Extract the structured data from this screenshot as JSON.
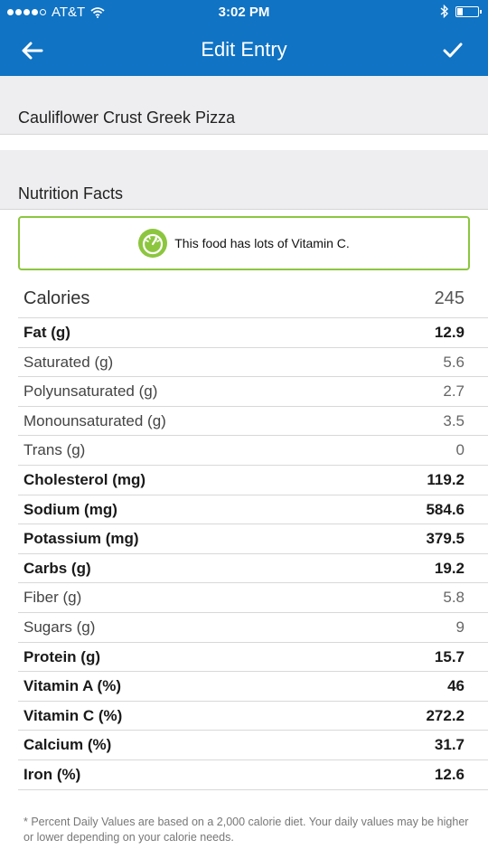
{
  "status_bar": {
    "carrier": "AT&T",
    "time": "3:02 PM",
    "signal_bars_filled": 4,
    "signal_bars_total": 5
  },
  "header": {
    "title": "Edit Entry",
    "back_icon": "arrow-left-icon",
    "confirm_icon": "checkmark-icon"
  },
  "food": {
    "name": "Cauliflower Crust Greek Pizza"
  },
  "nutrition": {
    "section_title": "Nutrition Facts",
    "highlight_text": "This food has lots of Vitamin C.",
    "calories_label": "Calories",
    "calories_value": "245",
    "rows": [
      {
        "label": "Fat (g)",
        "value": "12.9",
        "bold": true
      },
      {
        "label": "Saturated (g)",
        "value": "5.6",
        "bold": false
      },
      {
        "label": "Polyunsaturated (g)",
        "value": "2.7",
        "bold": false
      },
      {
        "label": "Monounsaturated (g)",
        "value": "3.5",
        "bold": false
      },
      {
        "label": "Trans (g)",
        "value": "0",
        "bold": false
      },
      {
        "label": "Cholesterol (mg)",
        "value": "119.2",
        "bold": true
      },
      {
        "label": "Sodium (mg)",
        "value": "584.6",
        "bold": true
      },
      {
        "label": "Potassium (mg)",
        "value": "379.5",
        "bold": true
      },
      {
        "label": "Carbs (g)",
        "value": "19.2",
        "bold": true
      },
      {
        "label": "Fiber (g)",
        "value": "5.8",
        "bold": false
      },
      {
        "label": "Sugars (g)",
        "value": "9",
        "bold": false
      },
      {
        "label": "Protein (g)",
        "value": "15.7",
        "bold": true
      },
      {
        "label": "Vitamin A (%)",
        "value": "46",
        "bold": true
      },
      {
        "label": "Vitamin C (%)",
        "value": "272.2",
        "bold": true
      },
      {
        "label": "Calcium (%)",
        "value": "31.7",
        "bold": true
      },
      {
        "label": "Iron (%)",
        "value": "12.6",
        "bold": true
      }
    ],
    "footnote": "* Percent Daily Values are based on a 2,000 calorie diet.  Your daily values may be higher or lower depending on your calorie needs."
  },
  "colors": {
    "header": "#1073c4",
    "accent_green": "#8cc63f",
    "band": "#eeeef0"
  }
}
